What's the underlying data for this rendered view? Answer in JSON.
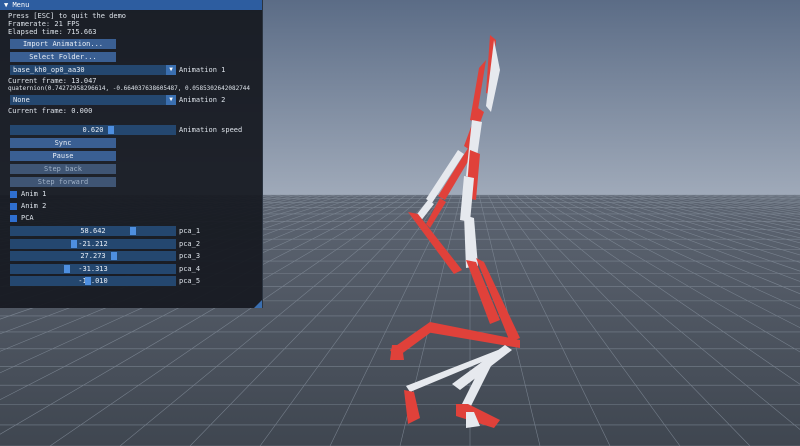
{
  "menu": {
    "title": "Menu",
    "collapse_icon": "triangle-down-icon",
    "info_lines": [
      "Press [ESC] to quit the demo",
      "Framerate: 21 FPS",
      "Elapsed time: 715.663"
    ],
    "import_button": "Import Animation...",
    "select_folder_button": "Select Folder...",
    "anim1_combo": "base_kh0_op0_aa30",
    "anim1_label": "Animation 1",
    "anim1_current_frame": "Current frame: 13.047",
    "anim1_quaternion": "quaternion(0.74272958296614, -0.664037638605487, 0.0585302642082744",
    "anim2_combo": "None",
    "anim2_label": "Animation 2",
    "anim2_current_frame": "Current frame: 0.000",
    "speed_value": "0.620",
    "speed_label": "Animation speed",
    "sync_button": "Sync",
    "pause_button": "Pause",
    "step_back_button": "Step back",
    "step_forward_button": "Step forward",
    "checkboxes": [
      "Anim 1",
      "Anim 2",
      "PCA"
    ],
    "pca": [
      {
        "value": "58.642",
        "label": "pca_1",
        "pos": 0.75
      },
      {
        "value": "-21.212",
        "label": "pca_2",
        "pos": 0.38
      },
      {
        "value": "27.273",
        "label": "pca_3",
        "pos": 0.63
      },
      {
        "value": "-31.313",
        "label": "pca_4",
        "pos": 0.34
      },
      {
        "value": "-11.010",
        "label": "pca_5",
        "pos": 0.47
      }
    ]
  },
  "colors": {
    "sky_top": "#5b6c86",
    "sky_bottom": "#a5b0bf",
    "floor": "#4e5662",
    "grid": "#7a8491",
    "bone_red": "#e0413a",
    "bone_white": "#e6e9ee",
    "accent": "#2d5da0"
  }
}
